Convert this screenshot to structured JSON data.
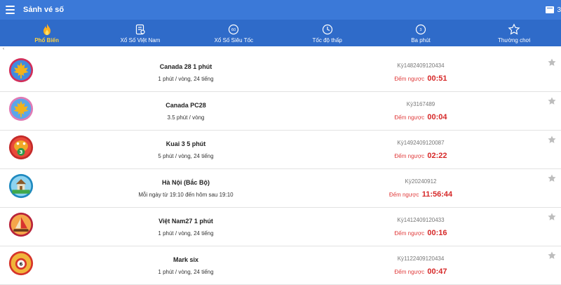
{
  "header": {
    "title": "Sảnh vé số",
    "right_text": "3"
  },
  "tabs": [
    {
      "label": "Phổ Biến",
      "active": true,
      "icon": "flame-icon"
    },
    {
      "label": "Xổ Số Việt Nam",
      "active": false,
      "icon": "ticket-icon"
    },
    {
      "label": "Xổ Số Siêu Tốc",
      "active": false,
      "icon": "clock-60s-icon"
    },
    {
      "label": "Tốc độ thấp",
      "active": false,
      "icon": "clock-icon"
    },
    {
      "label": "Ba phút",
      "active": false,
      "icon": "clock-3min-icon"
    },
    {
      "label": "Thường chơi",
      "active": false,
      "icon": "star-icon"
    }
  ],
  "list_marker": "‹",
  "colors": {
    "header": "#3b79d8",
    "tabs": "#2f6bc9",
    "active_tab": "#ffd23f",
    "countdown": "#d62828"
  },
  "games": [
    {
      "name": "Canada 28 1 phút",
      "sub": "1 phút / vòng, 24 tiếng",
      "period": "Kỳ1482409120434",
      "countdown_label": "Đếm ngược",
      "countdown": "00:51",
      "icon": "maple-leaf-icon"
    },
    {
      "name": "Canada PC28",
      "sub": "3.5 phút / vòng",
      "period": "Kỳ3167489",
      "countdown_label": "Đếm ngược",
      "countdown": "00:04",
      "icon": "maple-leaf-icon"
    },
    {
      "name": "Kuai 3 5 phút",
      "sub": "5 phút / vòng, 24 tiếng",
      "period": "Kỳ1492409120087",
      "countdown_label": "Đếm ngược",
      "countdown": "02:22",
      "icon": "lucky-toad-icon"
    },
    {
      "name": "Hà Nội (Bắc Bộ)",
      "sub": "Mỗi ngày từ 19:10 đến hôm sau 19:10",
      "period": "Kỳ20240912",
      "countdown_label": "Đếm ngược",
      "countdown": "11:56:44",
      "icon": "temple-icon"
    },
    {
      "name": "Việt Nam27 1 phút",
      "sub": "1 phút / vòng, 24 tiếng",
      "period": "Kỳ1412409120433",
      "countdown_label": "Đếm ngược",
      "countdown": "00:16",
      "icon": "sailboat-icon"
    },
    {
      "name": "Mark six",
      "sub": "1 phút / vòng, 24 tiếng",
      "period": "Kỳ1122409120434",
      "countdown_label": "Đếm ngược",
      "countdown": "00:47",
      "icon": "lottery-ball-icon"
    }
  ]
}
